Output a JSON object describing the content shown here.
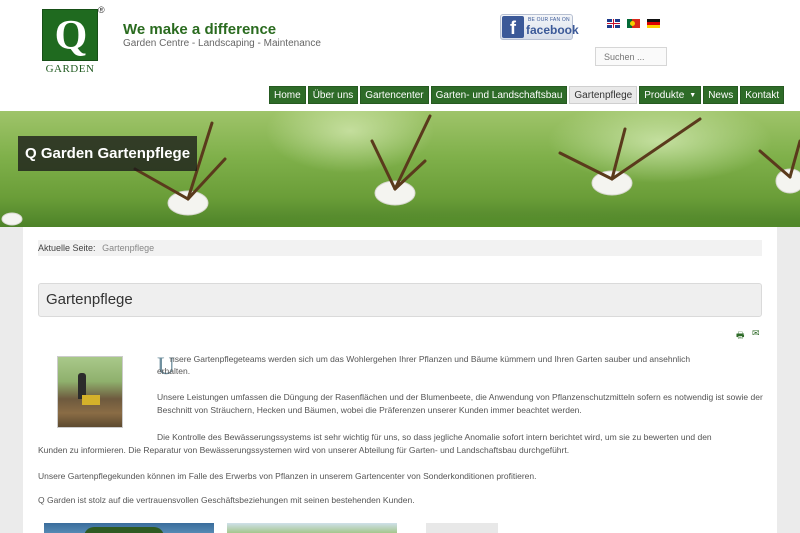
{
  "header": {
    "logo_letter": "Q",
    "logo_text": "GARDEN",
    "logo_reg": "®",
    "slogan": "We make a difference",
    "subslogan": "Garden Centre - Landscaping - Maintenance",
    "facebook_small": "BE OUR FAN ON",
    "facebook_word": "facebook",
    "languages": [
      "English",
      "Português",
      "Deutsch"
    ],
    "search_placeholder": "Suchen ..."
  },
  "nav": {
    "items": [
      {
        "label": "Home"
      },
      {
        "label": "Über uns"
      },
      {
        "label": "Gartencenter"
      },
      {
        "label": "Garten- und Landschaftsbau"
      },
      {
        "label": "Gartenpflege",
        "active": true
      },
      {
        "label": "Produkte",
        "has_dropdown": true
      },
      {
        "label": "News"
      },
      {
        "label": "Kontakt"
      }
    ]
  },
  "banner": {
    "title": "Q Garden Gartenpflege"
  },
  "breadcrumb": {
    "prefix": "Aktuelle Seite:",
    "current": "Gartenpflege"
  },
  "article": {
    "heading": "Gartenpflege",
    "dropcap": "U",
    "p1_first": "nsere Gartenpflegeteams werden sich um das Wohlergehen Ihrer Pflanzen und Bäume kümmern und Ihren Garten sauber und ansehnlich",
    "p1_rest": "erhalten.",
    "p2": "Unsere Leistungen umfassen die Düngung der Rasenflächen und der Blumenbeete, die Anwendung von Pflanzenschutzmitteln sofern es notwendig ist sowie der Beschnitt von Sträuchern, Hecken und Bäumen, wobei die Präferenzen unserer Kunden immer beachtet werden.",
    "p3a": "Die Kontrolle des Bewässerungssystems ist sehr wichtig für uns, so dass jegliche Anomalie sofort intern berichtet wird, um sie zu bewerten und den",
    "p3b": "Kunden zu informieren. Die Reparatur von Bewässerungssystemen wird von unserer Abteilung für Garten- und Landschaftsbau durchgeführt.",
    "p4": "Unsere Gartenpflegekunden können im Falle des Erwerbs von Pflanzen in unserem Gartencenter von Sonderkonditionen profitieren.",
    "p5": "Q Garden ist stolz auf die vertrauensvollen Geschäftsbeziehungen mit seinen bestehenden Kunden."
  },
  "icons": {
    "print": "print-icon",
    "mail": "mail-icon"
  },
  "colors": {
    "brand_green": "#2e6b28",
    "logo_green": "#1f6a1f",
    "facebook_blue": "#3b5998"
  }
}
